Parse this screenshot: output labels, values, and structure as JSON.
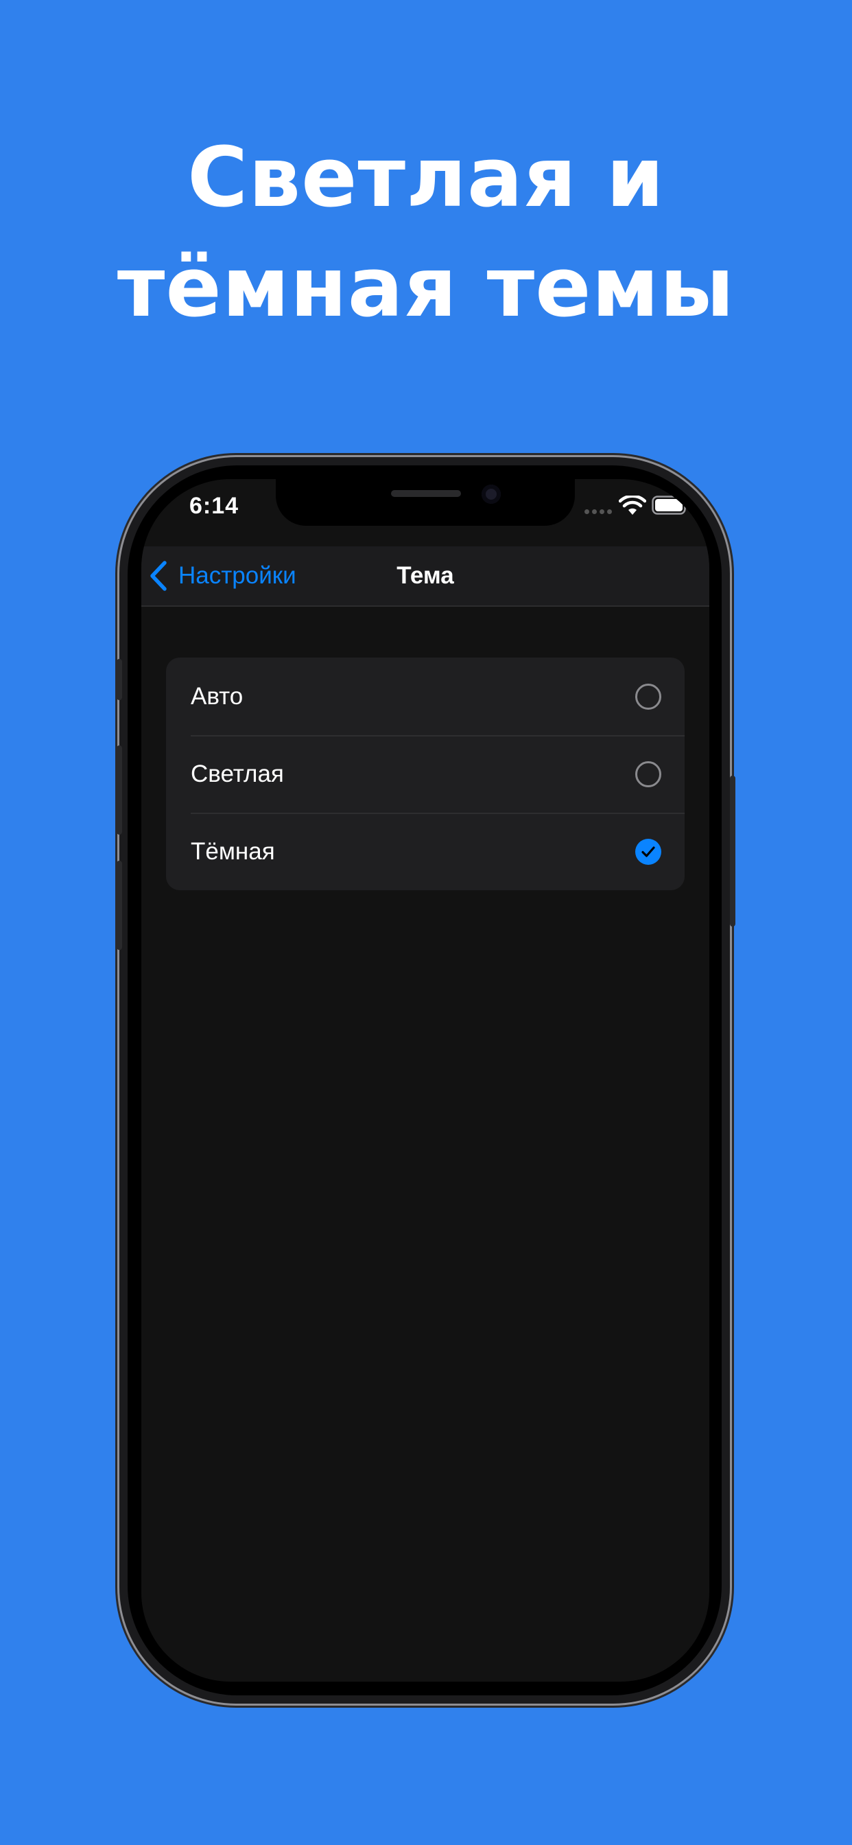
{
  "headline": {
    "line1": "Светлая и",
    "line2": "тёмная темы"
  },
  "status_bar": {
    "time": "6:14"
  },
  "nav": {
    "back_label": "Настройки",
    "title": "Тема"
  },
  "theme_options": [
    {
      "label": "Авто",
      "selected": false
    },
    {
      "label": "Светлая",
      "selected": false
    },
    {
      "label": "Тёмная",
      "selected": true
    }
  ],
  "colors": {
    "background": "#3081ED",
    "accent": "#0A84FF",
    "screen": "#121212",
    "group": "#1F1F21"
  },
  "icons": {
    "back": "chevron-left-icon",
    "wifi": "wifi-icon",
    "battery": "battery-icon",
    "checkmark": "checkmark-icon"
  }
}
